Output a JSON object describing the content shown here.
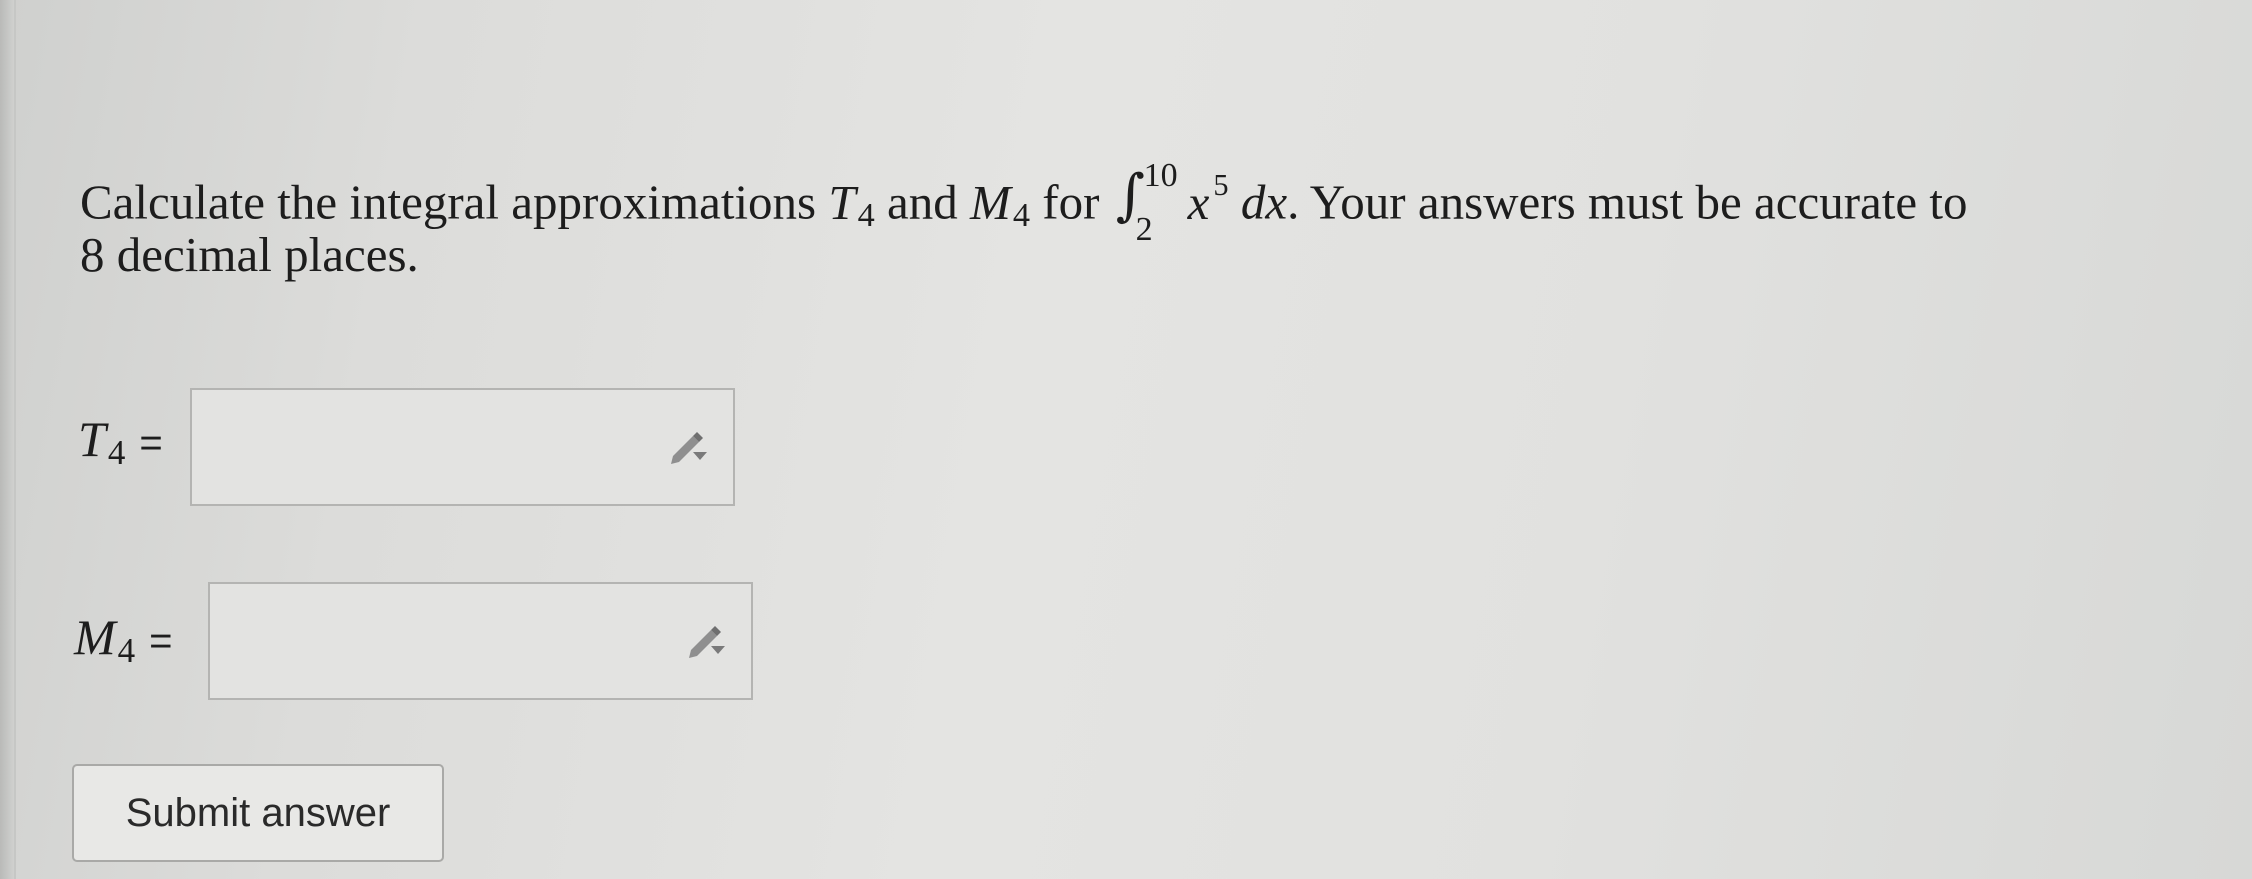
{
  "question": {
    "text_before_T": "Calculate the integral approximations ",
    "T_symbol": "T",
    "T_subscript": "4",
    "and_text": " and ",
    "M_symbol": "M",
    "M_subscript": "4",
    "for_text": " for ",
    "integral_sign": "∫",
    "integral_upper": "10",
    "integral_lower": "2",
    "integrand_var": "x",
    "integrand_exp": "5",
    "differential": "dx",
    "text_after": ". Your answers must be accurate to",
    "line2": "8 decimal places."
  },
  "answers": [
    {
      "symbol": "T",
      "subscript": "4",
      "equals": "=",
      "value": ""
    },
    {
      "symbol": "M",
      "subscript": "4",
      "equals": "=",
      "value": ""
    }
  ],
  "icons": {
    "answer_tool": "pencil-dropdown-icon"
  },
  "submit": {
    "label": "Submit answer"
  }
}
